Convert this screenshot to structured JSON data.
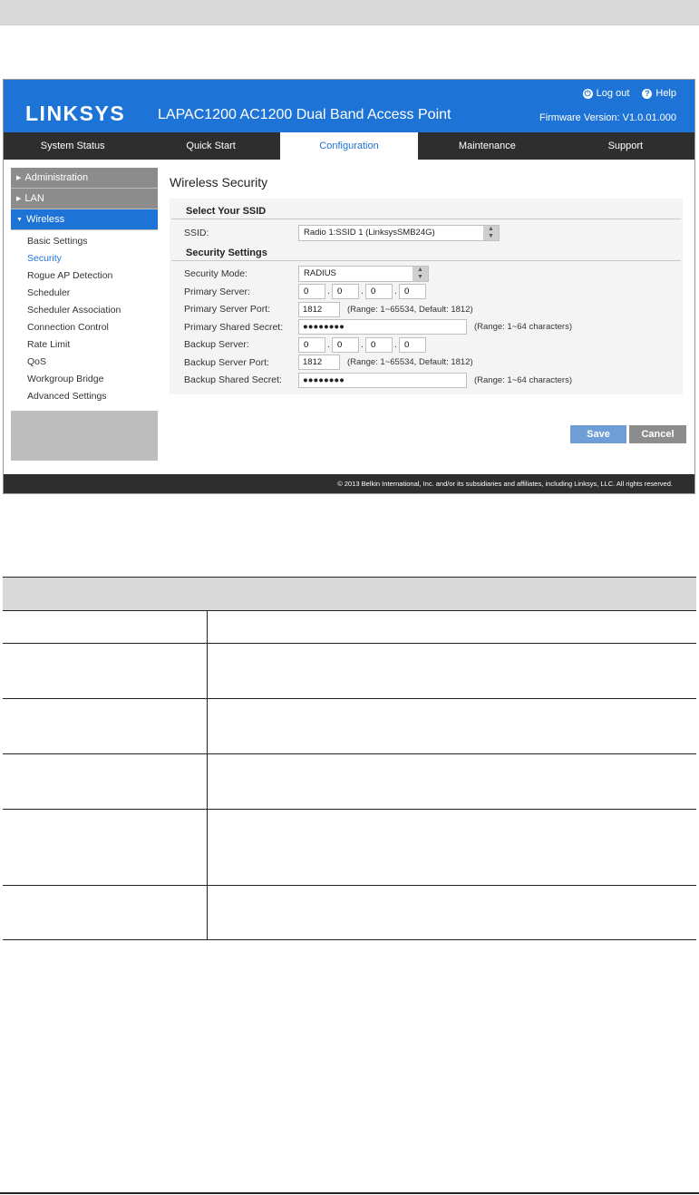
{
  "app": {
    "logo": "LINKSYS",
    "product_title": "LAPAC1200 AC1200 Dual Band Access Point",
    "logout": "Log out",
    "help": "Help",
    "firmware": "Firmware Version: V1.0.01.000",
    "accent_color": "#1e73d6"
  },
  "nav": {
    "tabs": [
      {
        "label": "System Status"
      },
      {
        "label": "Quick Start"
      },
      {
        "label": "Configuration",
        "active": true
      },
      {
        "label": "Maintenance"
      },
      {
        "label": "Support"
      }
    ]
  },
  "sidebar": {
    "sections": [
      {
        "label": "Administration"
      },
      {
        "label": "LAN"
      },
      {
        "label": "Wireless",
        "open": true
      }
    ],
    "items": [
      {
        "label": "Basic Settings"
      },
      {
        "label": "Security",
        "active": true
      },
      {
        "label": "Rogue AP Detection"
      },
      {
        "label": "Scheduler"
      },
      {
        "label": "Scheduler Association"
      },
      {
        "label": "Connection Control"
      },
      {
        "label": "Rate Limit"
      },
      {
        "label": "QoS"
      },
      {
        "label": "Workgroup Bridge"
      },
      {
        "label": "Advanced Settings"
      }
    ]
  },
  "main": {
    "heading": "Wireless Security",
    "ssid_section": {
      "title": "Select Your SSID",
      "ssid_label": "SSID:",
      "ssid_value": "Radio 1:SSID 1 (LinksysSMB24G)"
    },
    "security_section": {
      "title": "Security Settings",
      "mode_label": "Security Mode:",
      "mode_value": "RADIUS",
      "primary_server_label": "Primary Server:",
      "primary_server_octets": [
        "0",
        "0",
        "0",
        "0"
      ],
      "primary_port_label": "Primary Server Port:",
      "primary_port_value": "1812",
      "primary_port_hint": "(Range: 1~65534, Default: 1812)",
      "primary_secret_label": "Primary Shared Secret:",
      "primary_secret_value": "●●●●●●●●",
      "primary_secret_hint": "(Range: 1~64 characters)",
      "backup_server_label": "Backup Server:",
      "backup_server_octets": [
        "0",
        "0",
        "0",
        "0"
      ],
      "backup_port_label": "Backup Server Port:",
      "backup_port_value": "1812",
      "backup_port_hint": "(Range: 1~65534, Default: 1812)",
      "backup_secret_label": "Backup Shared Secret:",
      "backup_secret_value": "●●●●●●●●",
      "backup_secret_hint": "(Range: 1~64 characters)"
    },
    "buttons": {
      "save": "Save",
      "cancel": "Cancel"
    }
  },
  "footer": {
    "copyright": "© 2013 Belkin International, Inc. and/or its subsidiaries and affiliates, including Linksys, LLC. All rights reserved."
  }
}
